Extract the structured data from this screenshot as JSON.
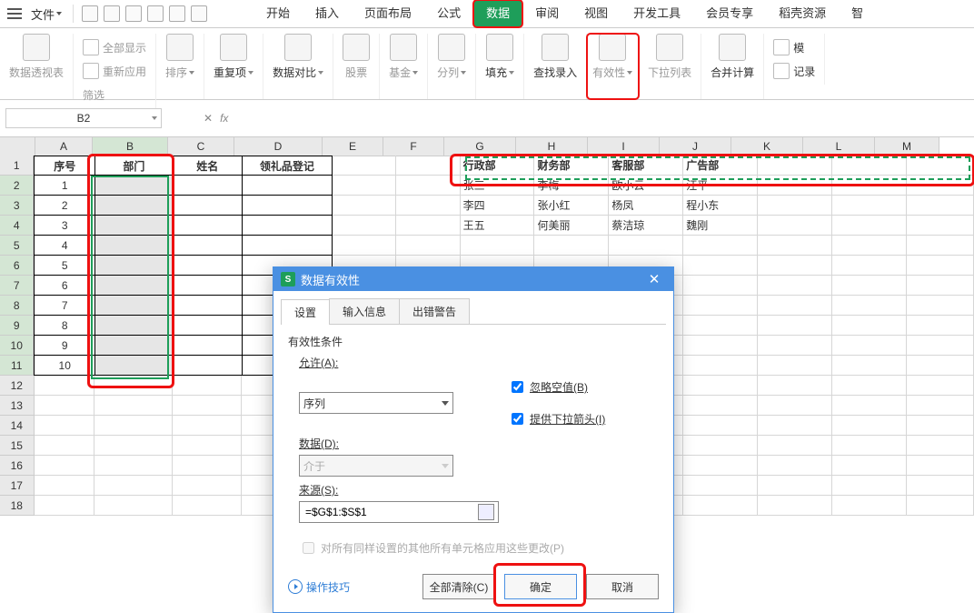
{
  "file_label": "文件",
  "tabs": {
    "start": "开始",
    "insert": "插入",
    "layout": "页面布局",
    "formula": "公式",
    "data": "数据",
    "review": "审阅",
    "view": "视图",
    "dev": "开发工具",
    "member": "会员专享",
    "daoke": "稻壳资源",
    "smart": "智"
  },
  "groups": {
    "pivot": "数据透视表",
    "filter": "筛选",
    "showall": "全部显示",
    "reapply": "重新应用",
    "sort": "排序",
    "dup": "重复项",
    "compare": "数据对比",
    "stock": "股票",
    "fund": "基金",
    "split": "分列",
    "fill": "填充",
    "lookup": "查找录入",
    "validity": "有效性",
    "dropdown": "下拉列表",
    "merge": "合并计算",
    "template": "模",
    "record": "记录"
  },
  "namebox": "B2",
  "columns": [
    "A",
    "B",
    "C",
    "D",
    "E",
    "F",
    "G",
    "H",
    "I",
    "J",
    "K",
    "L",
    "M"
  ],
  "headers": {
    "A": "序号",
    "B": "部门",
    "C": "姓名",
    "D": "领礼品登记"
  },
  "seq": [
    "1",
    "2",
    "3",
    "4",
    "5",
    "6",
    "7",
    "8",
    "9",
    "10"
  ],
  "depts": {
    "G": "行政部",
    "H": "财务部",
    "I": "客服部",
    "J": "广告部"
  },
  "names_row2": {
    "G": "张三",
    "H": "李梅",
    "I": "欧小云",
    "J": "汪平"
  },
  "names_row3": {
    "G": "李四",
    "H": "张小红",
    "I": "杨凤",
    "J": "程小东"
  },
  "names_row4": {
    "G": "王五",
    "H": "何美丽",
    "I": "蔡洁琼",
    "J": "魏刚"
  },
  "dialog": {
    "title": "数据有效性",
    "tabs": {
      "settings": "设置",
      "input": "输入信息",
      "error": "出错警告"
    },
    "section": "有效性条件",
    "allow_lbl": "允许(A):",
    "allow_val": "序列",
    "ignore_blank": "忽略空值(B)",
    "dropdown_chk": "提供下拉箭头(I)",
    "data_lbl": "数据(D):",
    "data_val": "介于",
    "source_lbl": "来源(S):",
    "source_val": "=$G$1:$S$1",
    "apply_all": "对所有同样设置的其他所有单元格应用这些更改(P)",
    "tips": "操作技巧",
    "clear": "全部清除(C)",
    "ok": "确定",
    "cancel": "取消"
  }
}
